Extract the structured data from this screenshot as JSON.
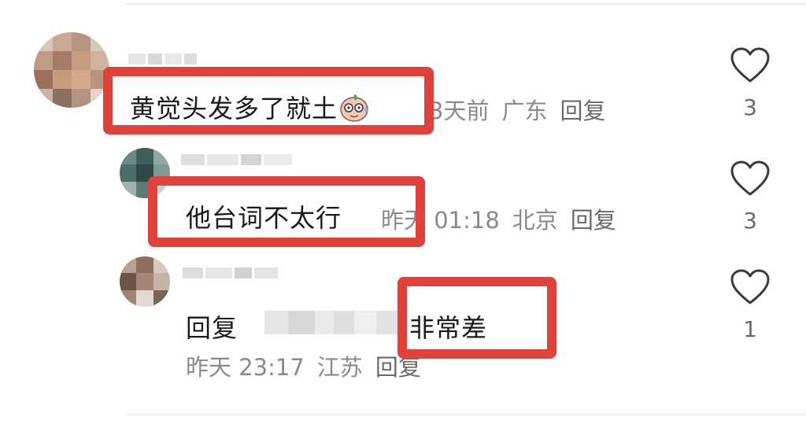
{
  "comments": [
    {
      "content": "黄觉头发多了就土",
      "time": "3天前",
      "location": "广东",
      "reply_label": "回复",
      "likes": "3",
      "emoji": "sweat-smile-emoji"
    },
    {
      "content": "他台词不太行",
      "time": "昨天 01:18",
      "location": "北京",
      "reply_label": "回复",
      "likes": "3"
    },
    {
      "reply_prefix": "回复",
      "content": "非常差",
      "time": "昨天 23:17",
      "location": "江苏",
      "reply_label": "回复",
      "likes": "1"
    }
  ],
  "colors": {
    "highlight": "#e0413a",
    "meta_text": "#8a8a8a",
    "heart_stroke": "#3a3a3a"
  }
}
